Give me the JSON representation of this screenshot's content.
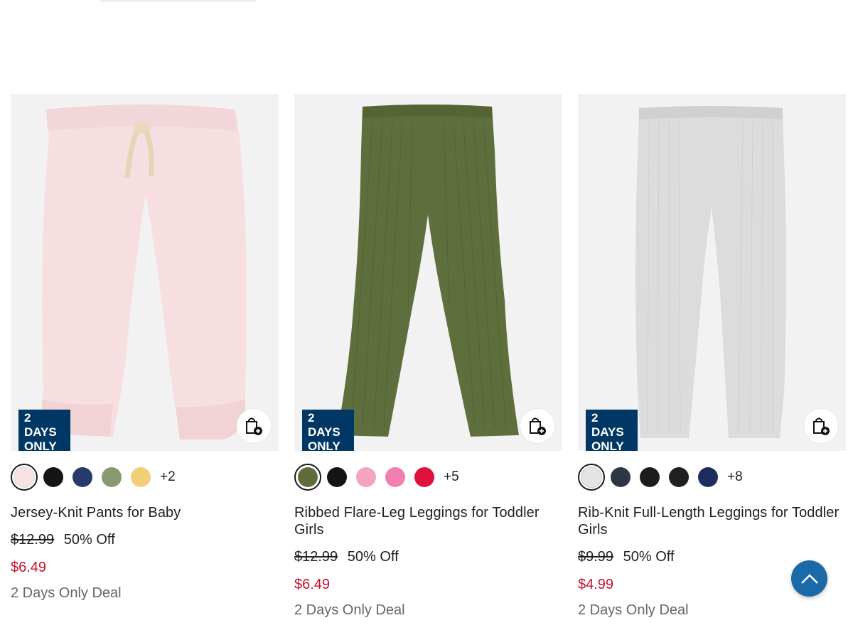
{
  "products": [
    {
      "title": "Jersey-Knit Pants for Baby",
      "badge_line1": "2 DAYS",
      "badge_line2": "ONLY",
      "original_price": "$12.99",
      "discount": "50% Off",
      "sale_price": "$6.49",
      "deal_text": "2 Days Only Deal",
      "more_colors": "+2",
      "swatch_colors": [
        "#f6e1e3",
        "#141414",
        "#243b6b",
        "#8a9a70",
        "#f0cf77"
      ],
      "product_color": "#f7dfe1",
      "icons": {
        "add_to_bag": "shopping-bag-plus-icon"
      }
    },
    {
      "title": "Ribbed Flare-Leg Leggings for Toddler Girls",
      "badge_line1": "2 DAYS",
      "badge_line2": "ONLY",
      "original_price": "$12.99",
      "discount": "50% Off",
      "sale_price": "$6.49",
      "deal_text": "2 Days Only Deal",
      "more_colors": "+5",
      "swatch_colors": [
        "#5f6d3c",
        "#141414",
        "#f4a3c0",
        "#f27fb3",
        "#e0103f"
      ],
      "product_color": "#5f6e3d",
      "icons": {
        "add_to_bag": "shopping-bag-plus-icon"
      }
    },
    {
      "title": "Rib-Knit Full-Length Leggings for Toddler Girls",
      "badge_line1": "2 DAYS",
      "badge_line2": "ONLY",
      "original_price": "$9.99",
      "discount": "50% Off",
      "sale_price": "$4.99",
      "deal_text": "2 Days Only Deal",
      "more_colors": "+8",
      "swatch_colors": [
        "#e4e4e4",
        "#2e3644",
        "#1c1c1c",
        "#202020",
        "#1f2d5e"
      ],
      "product_color": "#d9d9d9",
      "icons": {
        "add_to_bag": "shopping-bag-plus-icon"
      }
    }
  ],
  "colors": {
    "badge_bg": "#003764",
    "sale_red": "#c8102e",
    "scroll_btn": "#1a6aa8"
  },
  "icons": {
    "scroll_top": "chevron-up-icon"
  }
}
